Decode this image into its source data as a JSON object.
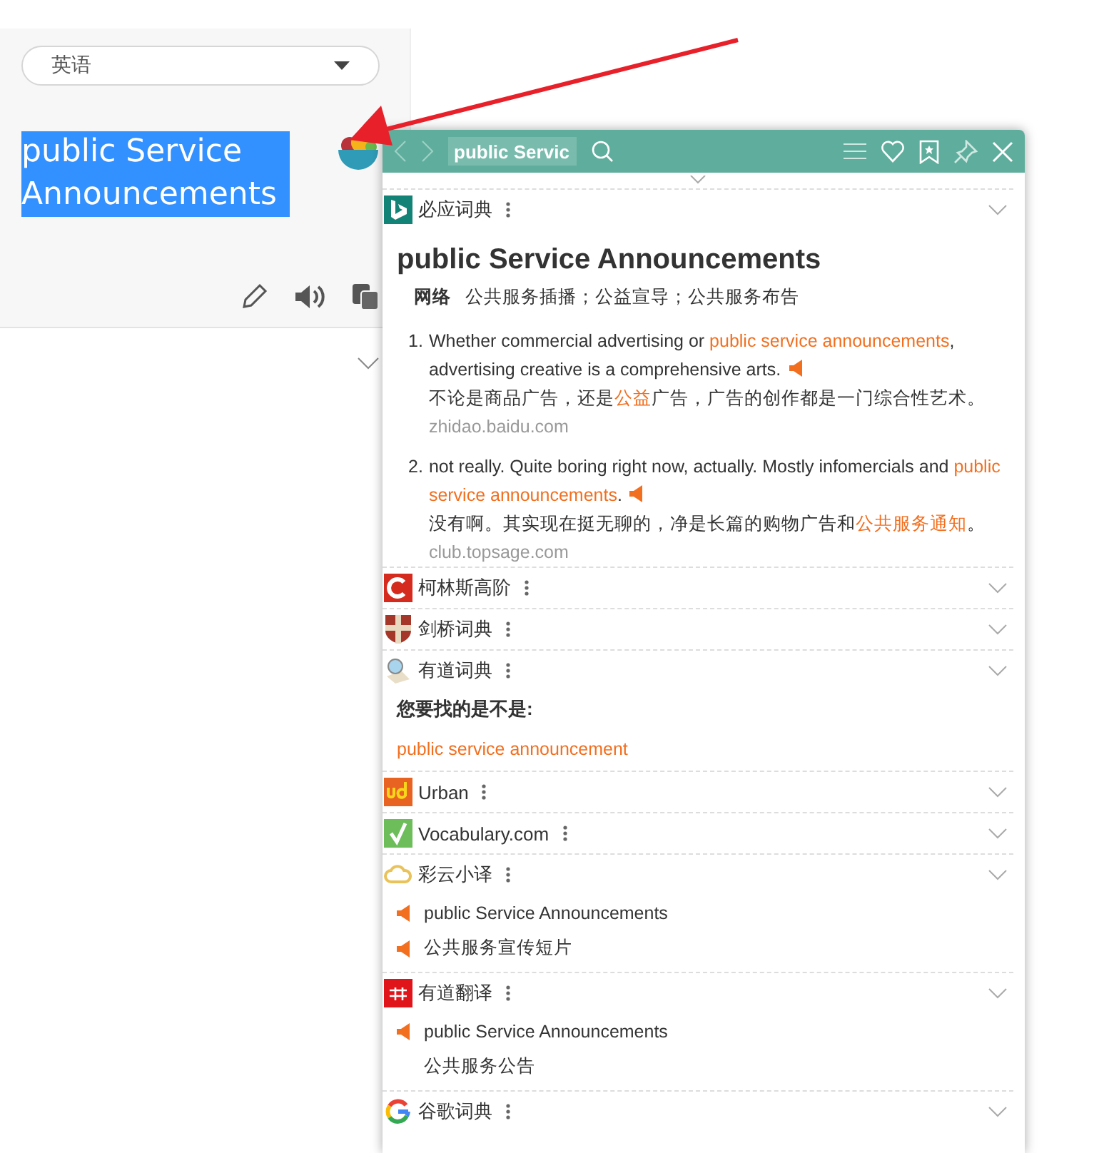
{
  "translator": {
    "language": "英语",
    "source_text": "public Service Announcements"
  },
  "popup": {
    "search_value": "public Servic",
    "sections": [
      {
        "kind": "bing",
        "name": "必应词典",
        "headword": "public Service Announcements",
        "sense_label": "网络",
        "sense": "公共服务插播；公益宣导；公共服务布告",
        "examples": [
          {
            "number": "1.",
            "english": [
              {
                "text": "Whether commercial advertising or ",
                "highlight": false
              },
              {
                "text": "public service announcements",
                "highlight": true
              },
              {
                "text": ", advertising creative is a comprehensive arts.",
                "highlight": false
              }
            ],
            "chinese": [
              {
                "text": "不论是商品广告，还是",
                "highlight": false
              },
              {
                "text": "公益",
                "highlight": true
              },
              {
                "text": "广告，广告的创作都是一门综合性艺术。",
                "highlight": false
              }
            ],
            "source": "zhidao.baidu.com"
          },
          {
            "number": "2.",
            "english": [
              {
                "text": "not really. Quite boring right now, actually. Mostly infomercials and ",
                "highlight": false
              },
              {
                "text": "public service announcements",
                "highlight": true
              },
              {
                "text": ".",
                "highlight": false
              }
            ],
            "chinese": [
              {
                "text": "没有啊。其实现在挺无聊的，净是长篇的购物广告和",
                "highlight": false
              },
              {
                "text": "公共服务通知",
                "highlight": true
              },
              {
                "text": "。",
                "highlight": false
              }
            ],
            "source": "club.topsage.com"
          }
        ]
      },
      {
        "kind": "collapsed",
        "name": "柯林斯高阶"
      },
      {
        "kind": "collapsed",
        "name": "剑桥词典"
      },
      {
        "kind": "suggest",
        "name": "有道词典",
        "prompt": "您要找的是不是:",
        "suggestion": "public service announcement"
      },
      {
        "kind": "collapsed",
        "name": "Urban"
      },
      {
        "kind": "collapsed",
        "name": "Vocabulary.com"
      },
      {
        "kind": "translation",
        "name": "彩云小译",
        "lines": [
          {
            "text": "public Service Announcements",
            "audio": true
          },
          {
            "text": "公共服务宣传短片",
            "audio": true
          }
        ]
      },
      {
        "kind": "translation",
        "name": "有道翻译",
        "lines": [
          {
            "text": "public Service Announcements",
            "audio": true
          },
          {
            "text": "公共服务公告",
            "audio": false
          }
        ]
      },
      {
        "kind": "collapsed",
        "name": "谷歌词典"
      }
    ]
  }
}
